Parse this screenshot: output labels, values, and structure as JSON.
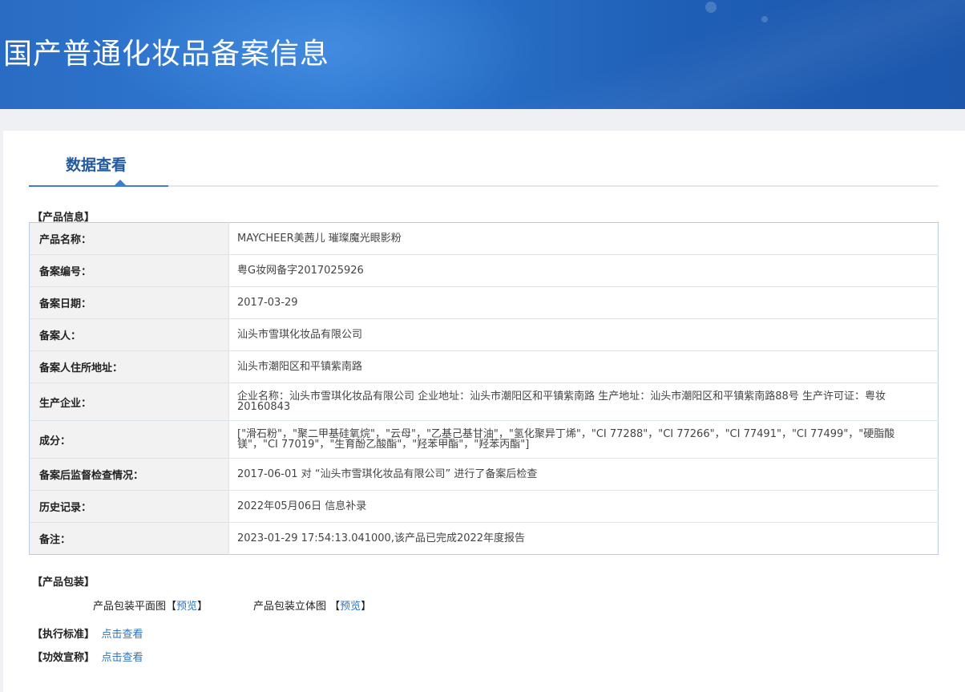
{
  "header": {
    "title": "国产普通化妆品备案信息"
  },
  "tab": {
    "label": "数据查看"
  },
  "product_section": {
    "title": "【产品信息】"
  },
  "rows": [
    {
      "key": "产品名称：",
      "value": "MAYCHEER美茜儿 璀璨魔光眼影粉"
    },
    {
      "key": "备案编号：",
      "value": "粤G妆网备字2017025926"
    },
    {
      "key": "备案日期：",
      "value": "2017-03-29"
    },
    {
      "key": "备案人：",
      "value": "汕头市雪琪化妆品有限公司"
    },
    {
      "key": "备案人住所地址：",
      "value": "汕头市潮阳区和平镇紫南路"
    },
    {
      "key": "生产企业：",
      "value": "企业名称：汕头市雪琪化妆品有限公司 企业地址：汕头市潮阳区和平镇紫南路 生产地址：汕头市潮阳区和平镇紫南路88号 生产许可证：粤妆20160843"
    },
    {
      "key": "成分：",
      "value": "[\"滑石粉\"，\"聚二甲基硅氧烷\"，\"云母\"，\"乙基己基甘油\"，\"氢化聚异丁烯\"，\"CI 77288\"，\"CI 77266\"，\"CI 77491\"，\"CI 77499\"，\"硬脂酸镁\"，\"CI 77019\"，\"生育酚乙酸酯\"，\"羟苯甲酯\"，\"羟苯丙酯\"]"
    },
    {
      "key": "备案后监督检查情况：",
      "value": "2017-06-01 对 “汕头市雪琪化妆品有限公司” 进行了备案后检查"
    },
    {
      "key": "历史记录：",
      "value": "2022年05月06日 信息补录"
    },
    {
      "key": "备注：",
      "value": "2023-01-29 17:54:13.041000,该产品已完成2022年度报告"
    }
  ],
  "packaging": {
    "title": "【产品包装】",
    "flat_label": "产品包装平面图",
    "flat_link": "预览",
    "solid_label": "产品包装立体图",
    "solid_link": "预览",
    "bracket_open": "【",
    "bracket_close": "】"
  },
  "standard": {
    "title": "【执行标准】",
    "link": "点击查看"
  },
  "efficacy": {
    "title": "【功效宣称】",
    "link": "点击查看"
  },
  "colors": {
    "header_blue": "#2f7ad3",
    "tab_text": "#235a9c",
    "link": "#2f74c0"
  }
}
